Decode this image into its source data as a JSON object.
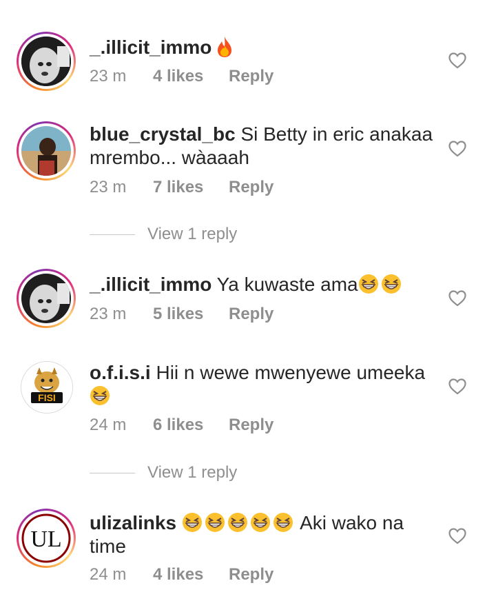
{
  "comments": [
    {
      "username": "_.illicit_immo",
      "text": "",
      "emojis_after": [
        "fire"
      ],
      "time": "23 m",
      "likes": "4 likes",
      "reply": "Reply"
    },
    {
      "username": "blue_crystal_bc",
      "text": " Si Betty in eric anakaa mrembo... wàaaah",
      "time": "23 m",
      "likes": "7 likes",
      "reply": "Reply",
      "view_replies": "View 1 reply"
    },
    {
      "username": "_.illicit_immo",
      "text": " Ya kuwaste ama",
      "emojis_after": [
        "grin",
        "grin"
      ],
      "time": "23 m",
      "likes": "5 likes",
      "reply": "Reply"
    },
    {
      "username": "o.f.i.s.i",
      "text": " Hii n wewe mwenyewe umeeka",
      "emojis_after": [
        "grin"
      ],
      "time": "24 m",
      "likes": "6 likes",
      "reply": "Reply",
      "view_replies": "View 1 reply",
      "avatar_label": "FISI"
    },
    {
      "username": "ulizalinks",
      "text_after_emojis": " Aki wako na time",
      "emojis_mid": [
        "grin",
        "grin",
        "grin",
        "grin",
        "grin"
      ],
      "time": "24 m",
      "likes": "4 likes",
      "reply": "Reply",
      "avatar_label": "UL"
    }
  ],
  "icons": {
    "like": "heart-outline-icon",
    "emoji": "grinning-squinting-face-emoji",
    "fire": "fire-emoji"
  },
  "colors": {
    "text": "#262626",
    "meta": "#8e8e8e",
    "story_ring": "#dd2a7b"
  }
}
